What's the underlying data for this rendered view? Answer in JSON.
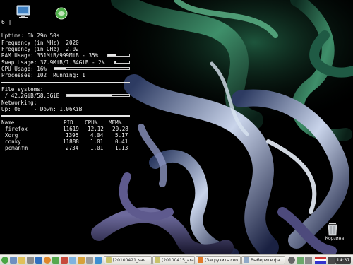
{
  "conky": {
    "command_line": "6 |",
    "uptime": "Uptime: 6h 29m 50s",
    "freq_mhz": "Frequency (in MHz): 2020",
    "freq_ghz": "Frequency (in GHz): 2.02",
    "ram": {
      "text": "RAM Usage: 351MiB/999MiB - 35%",
      "percent": 35
    },
    "swap": {
      "text": "Swap Usage: 37.9MiB/1.34GiB - 2%",
      "percent": 2
    },
    "cpu": {
      "text": "CPU Usage: 16%",
      "percent": 16
    },
    "processes": "Processes: 102  Running: 1",
    "filesystems_label": "File systems:",
    "filesystem_root": {
      "text": " / 42.2GiB/58.3GiB",
      "percent": 72
    },
    "networking_label": "Networking:",
    "network": "Up: 0B    - Down: 1.06KiB",
    "process_table": {
      "headers": [
        "Name",
        "PID",
        "CPU%",
        "MEM%"
      ],
      "rows": [
        [
          "firefox",
          "11619",
          "12.12",
          "20.28"
        ],
        [
          "Xorg",
          "1395",
          "4.04",
          "5.17"
        ],
        [
          "conky",
          "11888",
          "1.01",
          "0.41"
        ],
        [
          "pcmanfm",
          "2734",
          "1.01",
          "1.13"
        ]
      ]
    }
  },
  "desktop": {
    "icons": [
      {
        "name": "computer-icon"
      },
      {
        "name": "network-icon"
      },
      {
        "name": "trash-icon"
      }
    ],
    "trash_label": "Корзина"
  },
  "taskbar": {
    "tasks": [
      {
        "label": "[20100421_sav...",
        "icon_color": "#c9c26a"
      },
      {
        "label": "[20100415_ara...",
        "icon_color": "#c9c26a"
      },
      {
        "label": "[Загрузить сво...",
        "icon_color": "#e07a2a"
      },
      {
        "label": "Выберите фа...",
        "icon_color": "#8fa9c8"
      }
    ],
    "clock": "14:37"
  }
}
